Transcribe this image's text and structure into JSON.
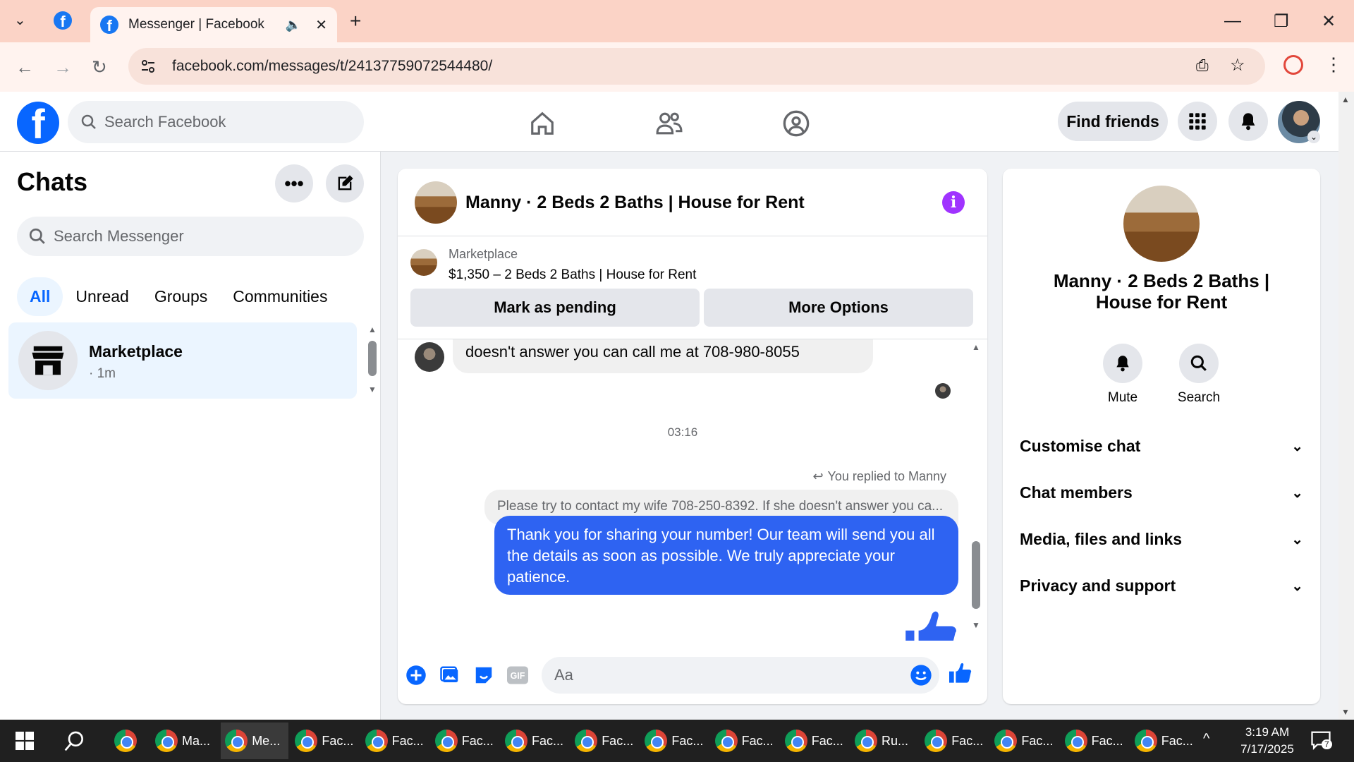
{
  "browser": {
    "tab_title": "Messenger | Facebook",
    "url": "facebook.com/messages/t/24137759072544480/"
  },
  "header": {
    "search_placeholder": "Search Facebook",
    "find_friends": "Find friends"
  },
  "sidebar": {
    "title": "Chats",
    "search_placeholder": "Search Messenger",
    "filters": [
      "All",
      "Unread",
      "Groups",
      "Communities"
    ],
    "active_filter": "All",
    "chats": [
      {
        "name": "Marketplace",
        "time": "· 1m"
      }
    ]
  },
  "conversation": {
    "title": "Manny · 2 Beds 2 Baths | House for Rent",
    "marketplace_label": "Marketplace",
    "listing": "$1,350 – 2 Beds 2 Baths | House for Rent",
    "mark_pending": "Mark as pending",
    "more_options": "More Options",
    "incoming_partial": "doesn't answer you can call me at 708-980-8055",
    "timestamp": "03:16",
    "replied_label": "You replied to Manny",
    "reply_quote": "Please try to contact my wife 708-250-8392. If she doesn't answer you ca...",
    "outgoing": "Thank you for sharing your number!  Our team will send you all the details as soon as possible. We truly appreciate your patience.",
    "composer_placeholder": "Aa"
  },
  "details": {
    "name": "Manny · 2 Beds 2 Baths | House for Rent",
    "actions": [
      "Mute",
      "Search"
    ],
    "sections": [
      "Customise chat",
      "Chat members",
      "Media, files and links",
      "Privacy and support"
    ]
  },
  "taskbar": {
    "apps": [
      "Ma...",
      "Me...",
      "Fac...",
      "Fac...",
      "Fac...",
      "Fac...",
      "Fac...",
      "Fac...",
      "Fac...",
      "Fac...",
      "Ru...",
      "Fac...",
      "Fac...",
      "Fac...",
      "Fac..."
    ],
    "time": "3:19 AM",
    "date": "7/17/2025",
    "notifications": "7"
  },
  "colors": {
    "brand": "#0866ff",
    "outgoing_bubble": "#2e63f2",
    "info_icon": "#a033ff"
  }
}
